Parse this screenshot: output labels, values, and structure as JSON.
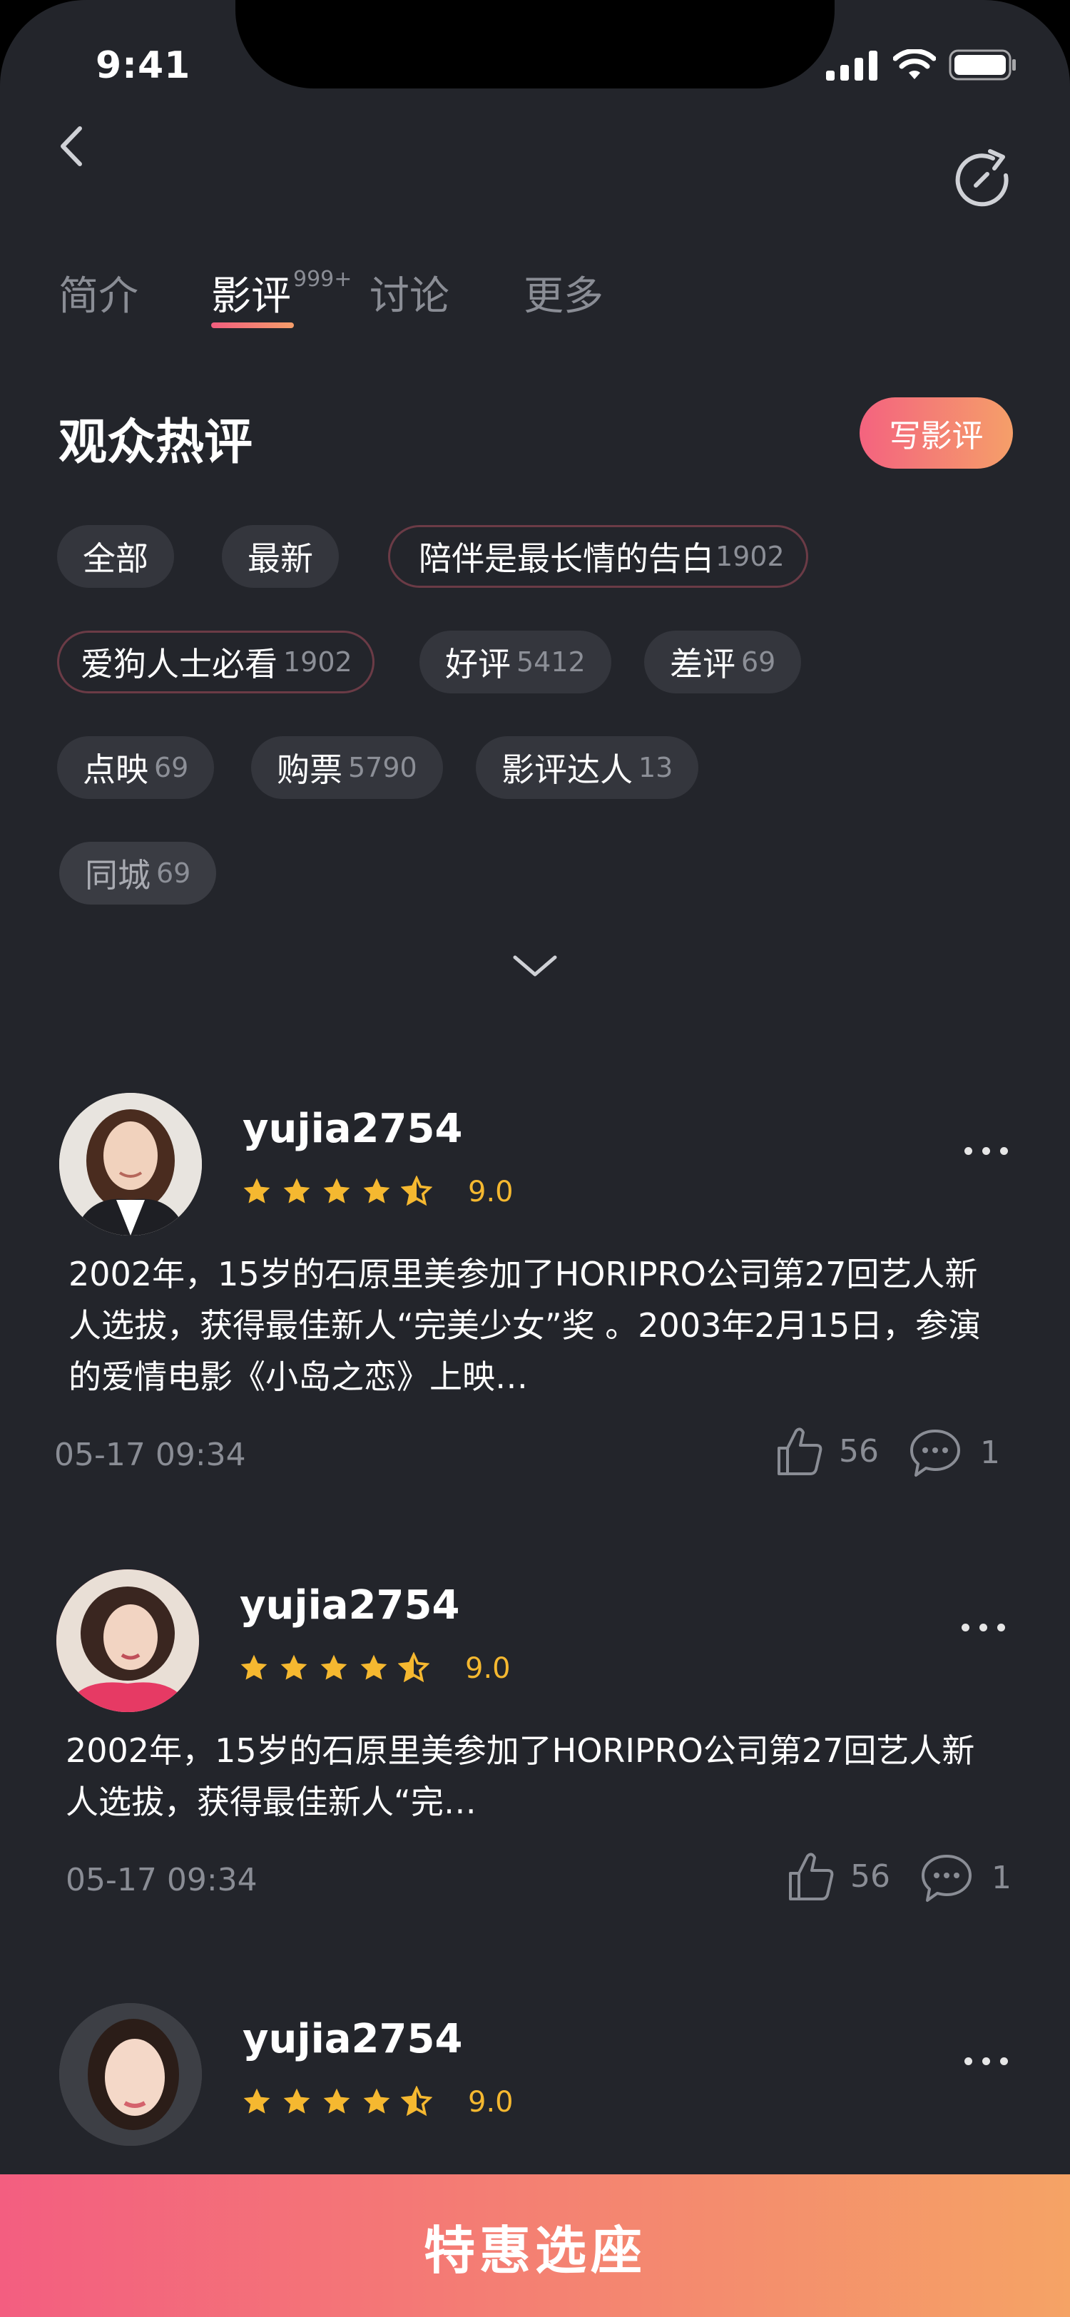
{
  "status": {
    "time": "9:41"
  },
  "tabs": [
    {
      "label": "简介"
    },
    {
      "label": "影评",
      "badge": "999+"
    },
    {
      "label": "讨论"
    },
    {
      "label": "更多"
    }
  ],
  "section": {
    "title": "观众热评",
    "write_label": "写影评"
  },
  "tags": [
    {
      "label": "全部",
      "count": ""
    },
    {
      "label": "最新",
      "count": ""
    },
    {
      "label": "陪伴是最长情的告白",
      "count": "1902"
    },
    {
      "label": "爱狗人士必看",
      "count": "1902"
    },
    {
      "label": "好评",
      "count": "5412"
    },
    {
      "label": "差评",
      "count": "69"
    },
    {
      "label": "点映",
      "count": "69"
    },
    {
      "label": "购票",
      "count": "5790"
    },
    {
      "label": "影评达人",
      "count": "13"
    },
    {
      "label": "同城",
      "count": "69"
    }
  ],
  "reviews": [
    {
      "username": "yujia2754",
      "rating": 4.5,
      "score": "9.0",
      "lines": [
        "2002年，15岁的石原里美参加了HORIPRO公司第27回艺人新",
        "人选拔，获得最佳新人“完美少女”奖 。2003年2月15日，参演",
        "的爱情电影《小岛之恋》上映…"
      ],
      "time": "05-17 09:34",
      "likes": "56",
      "comments": "1"
    },
    {
      "username": "yujia2754",
      "rating": 4.5,
      "score": "9.0",
      "lines": [
        "2002年，15岁的石原里美参加了HORIPRO公司第27回艺人新",
        "人选拔，获得最佳新人“完…"
      ],
      "time": "05-17 09:34",
      "likes": "56",
      "comments": "1"
    },
    {
      "username": "yujia2754",
      "rating": 4.5,
      "score": "9.0"
    }
  ],
  "cta": {
    "label": "特惠选座"
  },
  "colors": {
    "background": "#23252b",
    "accent_start": "#f35e80",
    "accent_end": "#f5a365",
    "star": "#f5b830"
  },
  "icons": [
    "back-arrow-icon",
    "refresh-icon",
    "chevron-down-icon",
    "thumbs-up-icon",
    "comment-icon",
    "more-dots-icon",
    "star-icon",
    "half-star-icon"
  ]
}
